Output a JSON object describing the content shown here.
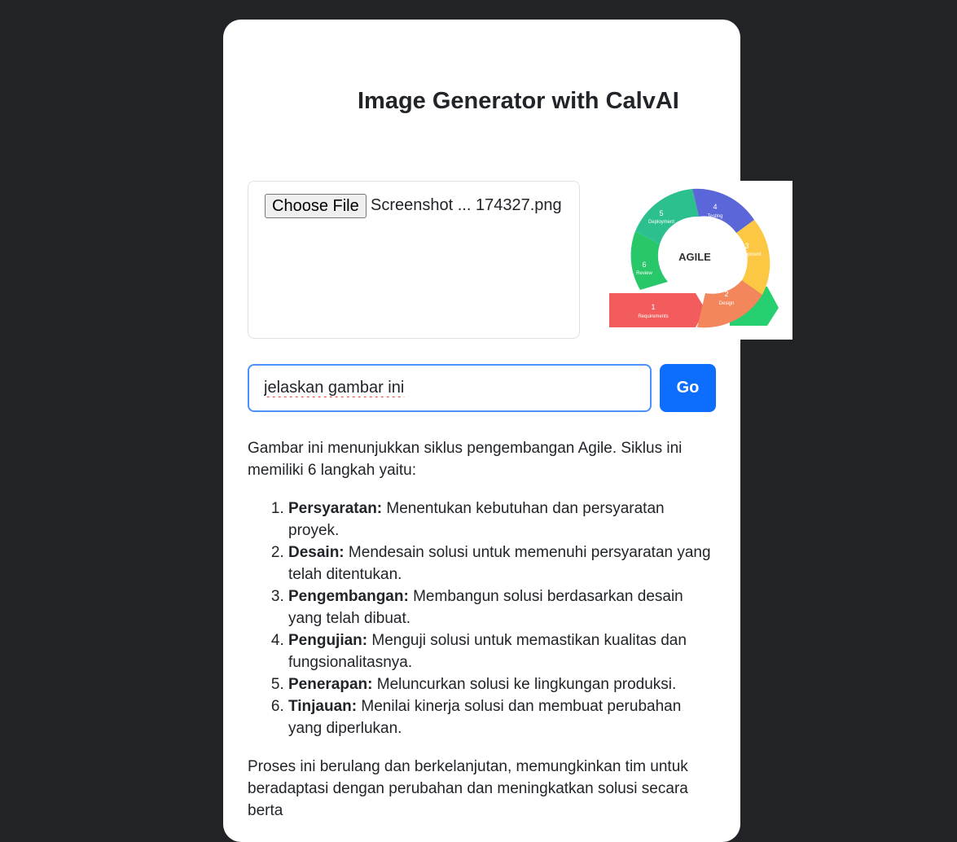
{
  "header": {
    "title": "Image Generator with CalvAI"
  },
  "upload": {
    "button_label": "Choose File",
    "file_name": "Screenshot ... 174327.png"
  },
  "preview": {
    "center_label": "AGILE",
    "steps": [
      {
        "num": "1",
        "label": "Requirements",
        "color": "#f25c5c"
      },
      {
        "num": "2",
        "label": "Design",
        "color": "#f3875b"
      },
      {
        "num": "3",
        "label": "Development",
        "color": "#fcc843"
      },
      {
        "num": "4",
        "label": "Testing",
        "color": "#5b67d8"
      },
      {
        "num": "5",
        "label": "Deployment",
        "color": "#2cc08f"
      },
      {
        "num": "6",
        "label": "Review",
        "color": "#28c86a"
      }
    ]
  },
  "prompt": {
    "value": "jelaskan gambar ini",
    "go_label": "Go"
  },
  "answer": {
    "intro": "Gambar ini menunjukkan siklus pengembangan Agile. Siklus ini memiliki 6 langkah yaitu:",
    "steps": [
      {
        "term": "Persyaratan:",
        "desc": " Menentukan kebutuhan dan persyaratan proyek."
      },
      {
        "term": "Desain:",
        "desc": " Mendesain solusi untuk memenuhi persyaratan yang telah ditentukan."
      },
      {
        "term": "Pengembangan:",
        "desc": " Membangun solusi berdasarkan desain yang telah dibuat."
      },
      {
        "term": "Pengujian:",
        "desc": " Menguji solusi untuk memastikan kualitas dan fungsionalitasnya."
      },
      {
        "term": "Penerapan:",
        "desc": " Meluncurkan solusi ke lingkungan produksi."
      },
      {
        "term": "Tinjauan:",
        "desc": " Menilai kinerja solusi dan membuat perubahan yang diperlukan."
      }
    ],
    "outro": "Proses ini berulang dan berkelanjutan, memungkinkan tim untuk beradaptasi dengan perubahan dan meningkatkan solusi secara berta"
  }
}
